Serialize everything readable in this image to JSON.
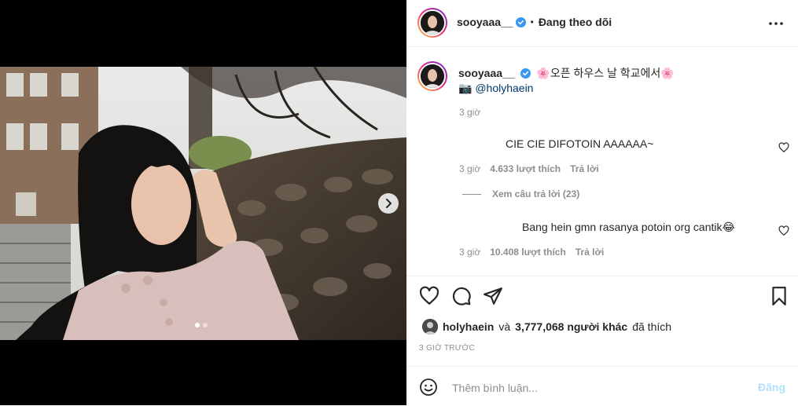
{
  "post": {
    "username": "sooyaaa__",
    "follow_separator": "•",
    "follow_status": "Đang theo dõi",
    "caption_user": "sooyaaa__",
    "caption_text": "🌸오픈 하우스 날 학교에서🌸",
    "caption_line2": "📷 @holyhaein",
    "caption_time": "3 giờ"
  },
  "comments": [
    {
      "text": "CIE CIE DIFOTOIN AAAAAA~",
      "time": "3 giờ",
      "likes": "4.633 lượt thích",
      "reply": "Trả lời",
      "view_replies": "Xem câu trả lời (23)"
    },
    {
      "text": "Bang hein gmn rasanya potoin org cantik😂",
      "time": "3 giờ",
      "likes": "10.408 lượt thích",
      "reply": "Trả lời"
    }
  ],
  "likes_summary": {
    "user": "holyhaein",
    "connector": "và",
    "others": "3,777,068 người khác",
    "suffix": "đã thích"
  },
  "time_ago": "3 GIỜ TRƯỚC",
  "comment_box": {
    "placeholder": "Thêm bình luận...",
    "post_label": "Đăng"
  },
  "carousel": {
    "current": 1,
    "total": 2
  },
  "colors": {
    "verified": "#3897f0",
    "post_disabled": "#b2dffc",
    "muted": "#8e8e8e"
  },
  "icons": [
    "verified-icon",
    "more-icon",
    "heart-icon",
    "comment-icon",
    "share-icon",
    "bookmark-icon",
    "emoji-icon",
    "chevron-right-icon"
  ]
}
